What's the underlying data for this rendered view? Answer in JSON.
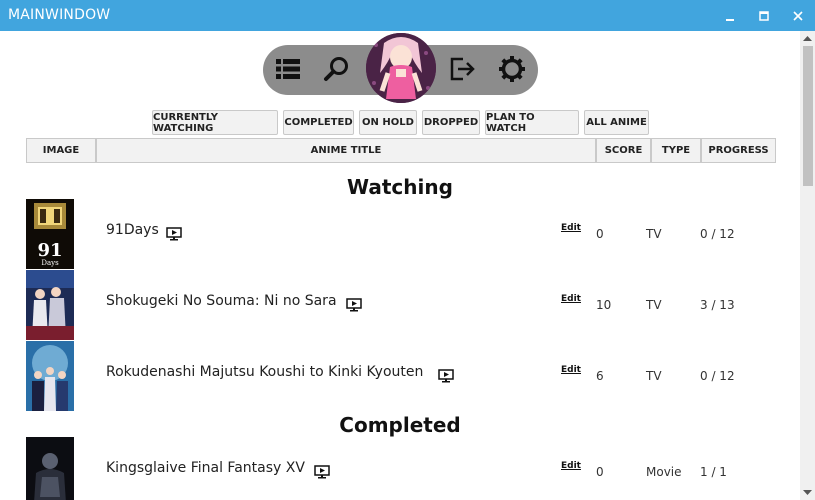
{
  "window": {
    "title": "MAINWINDOW"
  },
  "toolbar": {
    "icons": [
      "list-icon",
      "search-icon",
      "avatar",
      "logout-icon",
      "gear-icon"
    ]
  },
  "filters": [
    "CURRENTLY WATCHING",
    "COMPLETED",
    "ON HOLD",
    "DROPPED",
    "PLAN TO WATCH",
    "ALL ANIME"
  ],
  "columns": [
    "IMAGE",
    "ANIME TITLE",
    "SCORE",
    "TYPE",
    "PROGRESS"
  ],
  "sections": [
    {
      "heading": "Watching",
      "rows": [
        {
          "title": "91Days",
          "thumb_text": "91",
          "thumb_sub": "Days",
          "edit": "Edit",
          "score": "0",
          "type": "TV",
          "progress": "0 / 12"
        },
        {
          "title": "Shokugeki No Souma: Ni no Sara",
          "edit": "Edit",
          "score": "10",
          "type": "TV",
          "progress": "3 / 13"
        },
        {
          "title": "Rokudenashi Majutsu Koushi to Kinki Kyouten",
          "edit": "Edit",
          "score": "6",
          "type": "TV",
          "progress": "0 / 12"
        }
      ]
    },
    {
      "heading": "Completed",
      "rows": [
        {
          "title": "Kingsglaive Final Fantasy XV",
          "edit": "Edit",
          "score": "0",
          "type": "Movie",
          "progress": "1 / 1"
        }
      ]
    }
  ],
  "colors": {
    "titlebar": "#41a5de",
    "toolbar": "#8c8c8c",
    "header_bg": "#f2f2f2"
  }
}
